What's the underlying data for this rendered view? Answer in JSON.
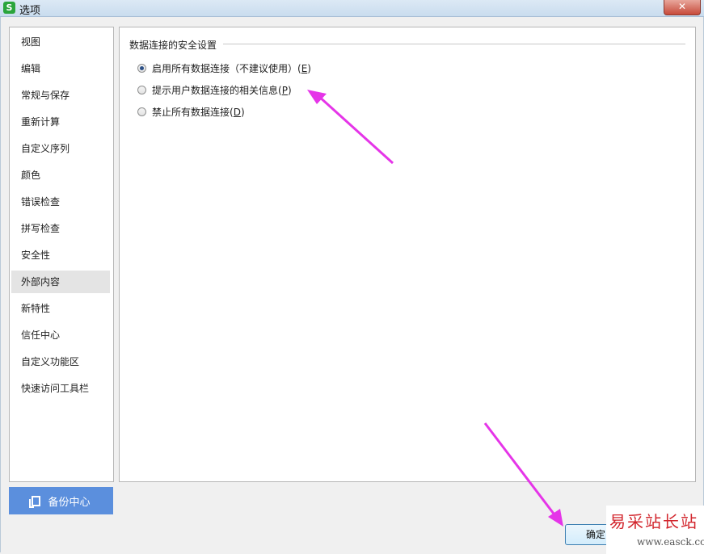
{
  "window": {
    "title": "选项",
    "app_icon": "S",
    "close_icon": "close-icon"
  },
  "sidebar": {
    "items": [
      {
        "label": "视图"
      },
      {
        "label": "编辑"
      },
      {
        "label": "常规与保存"
      },
      {
        "label": "重新计算"
      },
      {
        "label": "自定义序列"
      },
      {
        "label": "颜色"
      },
      {
        "label": "错误检查"
      },
      {
        "label": "拼写检查"
      },
      {
        "label": "安全性"
      },
      {
        "label": "外部内容",
        "active": true
      },
      {
        "label": "新特性"
      },
      {
        "label": "信任中心"
      },
      {
        "label": "自定义功能区"
      },
      {
        "label": "快速访问工具栏"
      }
    ]
  },
  "content": {
    "group_title": "数据连接的安全设置",
    "options": [
      {
        "label": "启用所有数据连接（不建议使用）(",
        "key": "E",
        "suffix": ")",
        "checked": true
      },
      {
        "label": "提示用户数据连接的相关信息(",
        "key": "P",
        "suffix": ")",
        "checked": false
      },
      {
        "label": "禁止所有数据连接(",
        "key": "D",
        "suffix": ")",
        "checked": false
      }
    ]
  },
  "footer": {
    "backup_label": "备份中心",
    "ok_label": "确定"
  },
  "watermark": {
    "line1": "易采站长站",
    "line2": "www.easck.com"
  },
  "colors": {
    "accent": "#5b8fdd",
    "annotation_arrow": "#e535e8",
    "active_item": "#e4e4e4"
  }
}
